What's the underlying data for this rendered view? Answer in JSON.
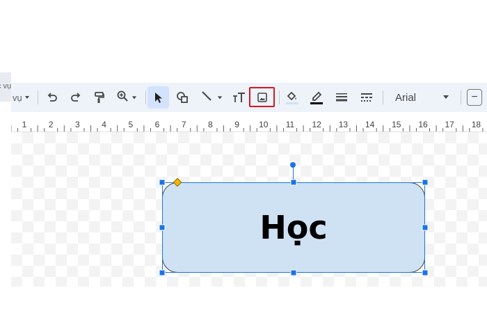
{
  "partial_tab": {
    "label": "c vụ"
  },
  "toolbar": {
    "mode_label": "vụ",
    "items": [
      {
        "name": "dropdown-arrow-icon"
      },
      {
        "name": "undo-icon"
      },
      {
        "name": "redo-icon"
      },
      {
        "name": "paint-format-icon"
      },
      {
        "name": "zoom-icon"
      },
      {
        "name": "select-icon",
        "selected": true
      },
      {
        "name": "shape-icon"
      },
      {
        "name": "line-icon"
      },
      {
        "name": "text-box-icon"
      },
      {
        "name": "insert-image-icon",
        "highlighted": true
      },
      {
        "name": "fill-color-icon"
      },
      {
        "name": "border-color-icon"
      },
      {
        "name": "border-weight-icon"
      },
      {
        "name": "border-dash-icon"
      }
    ],
    "font": "Arial",
    "minus_label": "−"
  },
  "ruler": {
    "numbers": [
      "1",
      "2",
      "3",
      "4",
      "5",
      "6",
      "7",
      "8",
      "9",
      "10",
      "11",
      "12",
      "13",
      "14",
      "15",
      "16",
      "17",
      "18"
    ]
  },
  "shape": {
    "text": "Học",
    "fill": "#cfe2f3"
  },
  "colors": {
    "accent": "#1a73e8",
    "highlight": "#d6161e",
    "toolbar_bg": "#eef2f9"
  }
}
